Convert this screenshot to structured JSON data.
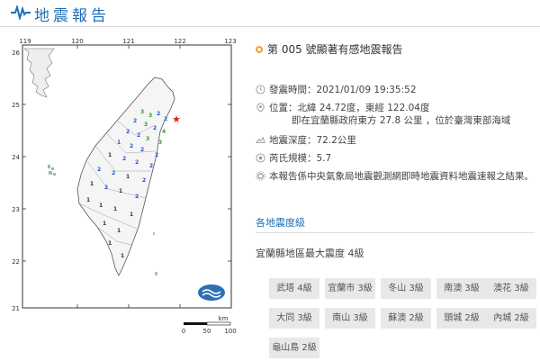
{
  "header": {
    "title": "地震報告"
  },
  "map": {
    "lon_ticks": [
      "119",
      "120",
      "121",
      "122",
      "123"
    ],
    "lat_ticks": [
      "26",
      "25",
      "24",
      "23",
      "22",
      "21"
    ],
    "scale_unit": "km",
    "scale_ticks": [
      "0",
      "50",
      "100"
    ]
  },
  "report": {
    "title": "第 005 號顯著有感地震報告",
    "time_label": "發震時間：",
    "time_value": "2021/01/09 19:35:52",
    "location_label": "位置：",
    "location_value": "北緯 24.72度，東經 122.04度",
    "location_detail": "即在宜蘭縣政府東方 27.8 公里 ，位於臺灣東部海域",
    "depth_label": "地震深度：",
    "depth_value": "72.2公里",
    "magnitude_label": "芮氏規模：",
    "magnitude_value": "5.7",
    "note": "本報告係中央氣象局地震觀測網即時地震資料地震速報之結果。"
  },
  "intensity": {
    "section_title": "各地震度級",
    "max_text": "宜蘭縣地區最大震度 4級",
    "areas": [
      "武塔 4級",
      "宜蘭市 3級",
      "冬山 3級",
      "南澳 3級",
      "澳花 3級",
      "大同 3級",
      "南山 3級",
      "蘇澳 2級",
      "頭城 2級",
      "內城 2級",
      "龜山島 2級"
    ]
  },
  "colors": {
    "accent": "#1e6fb8",
    "star": "#e02020",
    "chip_bg": "#e8e8e8"
  }
}
